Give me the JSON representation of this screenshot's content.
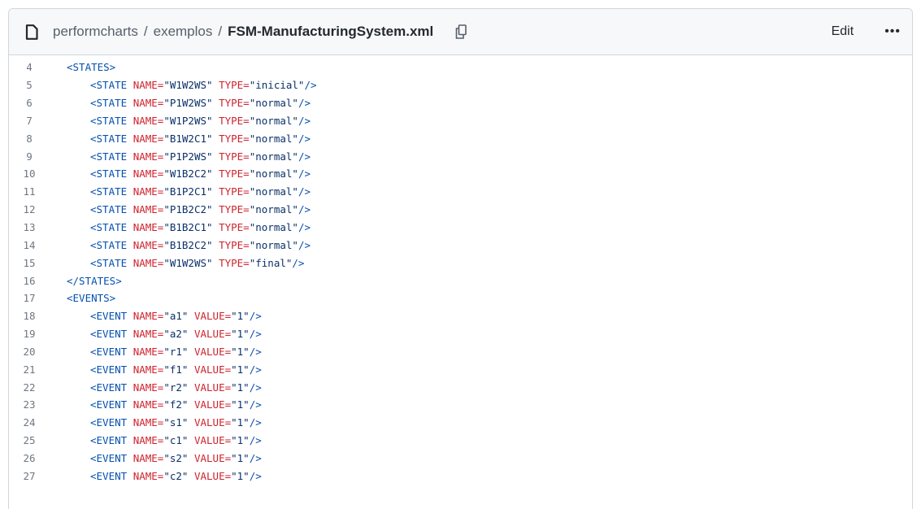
{
  "header": {
    "breadcrumb": [
      "performcharts",
      "exemplos"
    ],
    "separator": "/",
    "filename": "FSM-ManufacturingSystem.xml",
    "edit_label": "Edit",
    "more_label": "•••",
    "icons": {
      "file": "file-icon",
      "copy": "copy-icon",
      "more": "kebab-icon"
    }
  },
  "code": {
    "lines": [
      {
        "n": "4",
        "indent": 1,
        "t": [
          [
            "tag",
            "<STATES>"
          ]
        ]
      },
      {
        "n": "5",
        "indent": 2,
        "t": [
          [
            "tag",
            "<STATE "
          ],
          [
            "attr",
            "NAME="
          ],
          [
            "val",
            "\"W1W2WS\""
          ],
          [
            "tag",
            " "
          ],
          [
            "attr",
            "TYPE="
          ],
          [
            "val",
            "\"inicial\""
          ],
          [
            "tag",
            "/>"
          ]
        ]
      },
      {
        "n": "6",
        "indent": 2,
        "t": [
          [
            "tag",
            "<STATE "
          ],
          [
            "attr",
            "NAME="
          ],
          [
            "val",
            "\"P1W2WS\""
          ],
          [
            "tag",
            " "
          ],
          [
            "attr",
            "TYPE="
          ],
          [
            "val",
            "\"normal\""
          ],
          [
            "tag",
            "/>"
          ]
        ]
      },
      {
        "n": "7",
        "indent": 2,
        "t": [
          [
            "tag",
            "<STATE "
          ],
          [
            "attr",
            "NAME="
          ],
          [
            "val",
            "\"W1P2WS\""
          ],
          [
            "tag",
            " "
          ],
          [
            "attr",
            "TYPE="
          ],
          [
            "val",
            "\"normal\""
          ],
          [
            "tag",
            "/>"
          ]
        ]
      },
      {
        "n": "8",
        "indent": 2,
        "t": [
          [
            "tag",
            "<STATE "
          ],
          [
            "attr",
            "NAME="
          ],
          [
            "val",
            "\"B1W2C1\""
          ],
          [
            "tag",
            " "
          ],
          [
            "attr",
            "TYPE="
          ],
          [
            "val",
            "\"normal\""
          ],
          [
            "tag",
            "/>"
          ]
        ]
      },
      {
        "n": "9",
        "indent": 2,
        "t": [
          [
            "tag",
            "<STATE "
          ],
          [
            "attr",
            "NAME="
          ],
          [
            "val",
            "\"P1P2WS\""
          ],
          [
            "tag",
            " "
          ],
          [
            "attr",
            "TYPE="
          ],
          [
            "val",
            "\"normal\""
          ],
          [
            "tag",
            "/>"
          ]
        ]
      },
      {
        "n": "10",
        "indent": 2,
        "t": [
          [
            "tag",
            "<STATE "
          ],
          [
            "attr",
            "NAME="
          ],
          [
            "val",
            "\"W1B2C2\""
          ],
          [
            "tag",
            " "
          ],
          [
            "attr",
            "TYPE="
          ],
          [
            "val",
            "\"normal\""
          ],
          [
            "tag",
            "/>"
          ]
        ]
      },
      {
        "n": "11",
        "indent": 2,
        "t": [
          [
            "tag",
            "<STATE "
          ],
          [
            "attr",
            "NAME="
          ],
          [
            "val",
            "\"B1P2C1\""
          ],
          [
            "tag",
            " "
          ],
          [
            "attr",
            "TYPE="
          ],
          [
            "val",
            "\"normal\""
          ],
          [
            "tag",
            "/>"
          ]
        ]
      },
      {
        "n": "12",
        "indent": 2,
        "t": [
          [
            "tag",
            "<STATE "
          ],
          [
            "attr",
            "NAME="
          ],
          [
            "val",
            "\"P1B2C2\""
          ],
          [
            "tag",
            " "
          ],
          [
            "attr",
            "TYPE="
          ],
          [
            "val",
            "\"normal\""
          ],
          [
            "tag",
            "/>"
          ]
        ]
      },
      {
        "n": "13",
        "indent": 2,
        "t": [
          [
            "tag",
            "<STATE "
          ],
          [
            "attr",
            "NAME="
          ],
          [
            "val",
            "\"B1B2C1\""
          ],
          [
            "tag",
            " "
          ],
          [
            "attr",
            "TYPE="
          ],
          [
            "val",
            "\"normal\""
          ],
          [
            "tag",
            "/>"
          ]
        ]
      },
      {
        "n": "14",
        "indent": 2,
        "t": [
          [
            "tag",
            "<STATE "
          ],
          [
            "attr",
            "NAME="
          ],
          [
            "val",
            "\"B1B2C2\""
          ],
          [
            "tag",
            " "
          ],
          [
            "attr",
            "TYPE="
          ],
          [
            "val",
            "\"normal\""
          ],
          [
            "tag",
            "/>"
          ]
        ]
      },
      {
        "n": "15",
        "indent": 2,
        "t": [
          [
            "tag",
            "<STATE "
          ],
          [
            "attr",
            "NAME="
          ],
          [
            "val",
            "\"W1W2WS\""
          ],
          [
            "tag",
            " "
          ],
          [
            "attr",
            "TYPE="
          ],
          [
            "val",
            "\"final\""
          ],
          [
            "tag",
            "/>"
          ]
        ]
      },
      {
        "n": "16",
        "indent": 1,
        "t": [
          [
            "tag",
            "</STATES>"
          ]
        ]
      },
      {
        "n": "17",
        "indent": 1,
        "t": [
          [
            "tag",
            "<EVENTS>"
          ]
        ]
      },
      {
        "n": "18",
        "indent": 2,
        "t": [
          [
            "tag",
            "<EVENT "
          ],
          [
            "attr",
            "NAME="
          ],
          [
            "val",
            "\"a1\""
          ],
          [
            "tag",
            " "
          ],
          [
            "attr",
            "VALUE="
          ],
          [
            "val",
            "\"1\""
          ],
          [
            "tag",
            "/>"
          ]
        ]
      },
      {
        "n": "19",
        "indent": 2,
        "t": [
          [
            "tag",
            "<EVENT "
          ],
          [
            "attr",
            "NAME="
          ],
          [
            "val",
            "\"a2\""
          ],
          [
            "tag",
            " "
          ],
          [
            "attr",
            "VALUE="
          ],
          [
            "val",
            "\"1\""
          ],
          [
            "tag",
            "/>"
          ]
        ]
      },
      {
        "n": "20",
        "indent": 2,
        "t": [
          [
            "tag",
            "<EVENT "
          ],
          [
            "attr",
            "NAME="
          ],
          [
            "val",
            "\"r1\""
          ],
          [
            "tag",
            " "
          ],
          [
            "attr",
            "VALUE="
          ],
          [
            "val",
            "\"1\""
          ],
          [
            "tag",
            "/>"
          ]
        ]
      },
      {
        "n": "21",
        "indent": 2,
        "t": [
          [
            "tag",
            "<EVENT "
          ],
          [
            "attr",
            "NAME="
          ],
          [
            "val",
            "\"f1\""
          ],
          [
            "tag",
            " "
          ],
          [
            "attr",
            "VALUE="
          ],
          [
            "val",
            "\"1\""
          ],
          [
            "tag",
            "/>"
          ]
        ]
      },
      {
        "n": "22",
        "indent": 2,
        "t": [
          [
            "tag",
            "<EVENT "
          ],
          [
            "attr",
            "NAME="
          ],
          [
            "val",
            "\"r2\""
          ],
          [
            "tag",
            " "
          ],
          [
            "attr",
            "VALUE="
          ],
          [
            "val",
            "\"1\""
          ],
          [
            "tag",
            "/>"
          ]
        ]
      },
      {
        "n": "23",
        "indent": 2,
        "t": [
          [
            "tag",
            "<EVENT "
          ],
          [
            "attr",
            "NAME="
          ],
          [
            "val",
            "\"f2\""
          ],
          [
            "tag",
            " "
          ],
          [
            "attr",
            "VALUE="
          ],
          [
            "val",
            "\"1\""
          ],
          [
            "tag",
            "/>"
          ]
        ]
      },
      {
        "n": "24",
        "indent": 2,
        "t": [
          [
            "tag",
            "<EVENT "
          ],
          [
            "attr",
            "NAME="
          ],
          [
            "val",
            "\"s1\""
          ],
          [
            "tag",
            " "
          ],
          [
            "attr",
            "VALUE="
          ],
          [
            "val",
            "\"1\""
          ],
          [
            "tag",
            "/>"
          ]
        ]
      },
      {
        "n": "25",
        "indent": 2,
        "t": [
          [
            "tag",
            "<EVENT "
          ],
          [
            "attr",
            "NAME="
          ],
          [
            "val",
            "\"c1\""
          ],
          [
            "tag",
            " "
          ],
          [
            "attr",
            "VALUE="
          ],
          [
            "val",
            "\"1\""
          ],
          [
            "tag",
            "/>"
          ]
        ]
      },
      {
        "n": "26",
        "indent": 2,
        "t": [
          [
            "tag",
            "<EVENT "
          ],
          [
            "attr",
            "NAME="
          ],
          [
            "val",
            "\"s2\""
          ],
          [
            "tag",
            " "
          ],
          [
            "attr",
            "VALUE="
          ],
          [
            "val",
            "\"1\""
          ],
          [
            "tag",
            "/>"
          ]
        ]
      },
      {
        "n": "27",
        "indent": 2,
        "t": [
          [
            "tag",
            "<EVENT "
          ],
          [
            "attr",
            "NAME="
          ],
          [
            "val",
            "\"c2\""
          ],
          [
            "tag",
            " "
          ],
          [
            "attr",
            "VALUE="
          ],
          [
            "val",
            "\"1\""
          ],
          [
            "tag",
            "/>"
          ]
        ]
      }
    ]
  }
}
